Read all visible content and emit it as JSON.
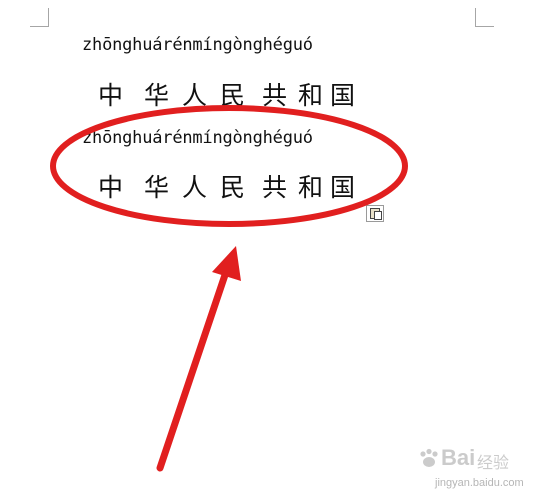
{
  "document": {
    "lines": [
      {
        "pinyin": "zhōnghuárénmíngònghéguó",
        "hanzi": [
          "中",
          "华",
          "人",
          "民",
          "共",
          "和",
          "国"
        ]
      },
      {
        "pinyin": "zhōnghuárénmíngònghéguó",
        "hanzi": [
          "中",
          "华",
          "人",
          "民",
          "共",
          "和",
          "国"
        ]
      }
    ]
  },
  "annotation": {
    "color": "#e11f1f",
    "shapes": [
      "ellipse-highlight",
      "arrow-pointer"
    ]
  },
  "paste_options": {
    "icon": "clipboard-paste-icon"
  },
  "watermark": {
    "brand": "Bai",
    "brand_suffix": "经验",
    "url": "jingyan.baidu.com",
    "icon": "paw-icon"
  }
}
